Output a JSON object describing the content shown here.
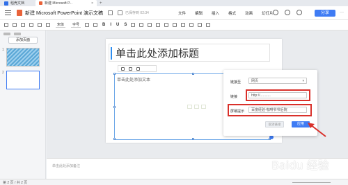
{
  "titlebar": {
    "app_name": "稻壳文档",
    "tab_title": "新建 Microsoft P...",
    "close_glyph": "×",
    "plus_glyph": "+"
  },
  "header": {
    "doc_title": "新建 Microsoft PowerPoint 演示文稿",
    "save_status": "已保存到 02:34",
    "menus": [
      "文件",
      "编辑",
      "插入",
      "格式",
      "动画",
      "幻灯片"
    ],
    "share_label": "分享",
    "more_glyph": "···"
  },
  "format_toolbar": {
    "font_name": "宋体",
    "font_size": "字号",
    "bold": "B",
    "italic": "I",
    "underline": "U",
    "strike": "S"
  },
  "sidebar": {
    "add_slide_label": "添加页面",
    "slides": [
      {
        "number": "1"
      },
      {
        "number": "2"
      }
    ]
  },
  "slide": {
    "title_placeholder": "单击此处添加标题",
    "content_placeholder": "单击此处添加文本"
  },
  "link_panel": {
    "link_to_label": "链接至",
    "link_to_value": "网页",
    "link_label": "链接",
    "link_value": "http://...........",
    "tooltip_label": "屏幕提示",
    "tooltip_value": "百度经验-咖啡爷爷后院",
    "cancel_label": "取消链接",
    "apply_label": "应用"
  },
  "notes": {
    "placeholder": "单击此处添加备注"
  },
  "statusbar": {
    "text": "第 2 页 / 共 2 页"
  },
  "watermark": {
    "text": "Baidu 经验"
  },
  "colors": {
    "accent": "#3f7cf4",
    "highlight_red": "#d9302a",
    "title_bar_blue": "#2e8ef0"
  }
}
